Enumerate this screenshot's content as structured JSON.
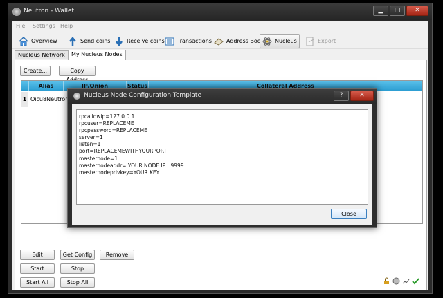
{
  "window": {
    "title": "Neutron - Wallet",
    "minimize": "▁",
    "maximize": "□",
    "close": "✕"
  },
  "menu": [
    "File",
    "Settings",
    "Help"
  ],
  "toolbar": {
    "overview": "Overview",
    "send": "Send coins",
    "receive": "Receive coins",
    "transactions": "Transactions",
    "address_book": "Address Book",
    "nucleus": "Nucleus",
    "export": "Export"
  },
  "tabs": {
    "network": "Nucleus Network",
    "my_nodes": "My Nucleus Nodes"
  },
  "actions": {
    "create": "Create...",
    "copy": "Copy Address"
  },
  "table": {
    "headers": [
      "Alias",
      "IP/Onion",
      "Status",
      "Collateral Address"
    ],
    "rows": [
      {
        "num": "1",
        "alias": "Oicu8Neutrons"
      }
    ]
  },
  "bottom_buttons": {
    "edit": "Edit",
    "get_config": "Get Config",
    "remove": "Remove",
    "start": "Start",
    "stop": "Stop",
    "start_all": "Start All",
    "stop_all": "Stop All"
  },
  "dialog": {
    "title": "Nucleus Node Configuration Template",
    "help": "?",
    "close_x": "✕",
    "config_text": "rpcallowip=127.0.0.1\nrpcuser=REPLACEME\nrpcpassword=REPLACEME\nserver=1\nlisten=1\nport=REPLACEMEWITHYOURPORT\nmasternode=1\nmasternodeaddr= YOUR NODE IP  :9999\nmasternodeprivkey=YOUR KEY",
    "close_button": "Close"
  },
  "colors": {
    "header_blue": "#2c9ed2",
    "titlebar": "#2a2a2a",
    "close_red": "#c0392b"
  }
}
